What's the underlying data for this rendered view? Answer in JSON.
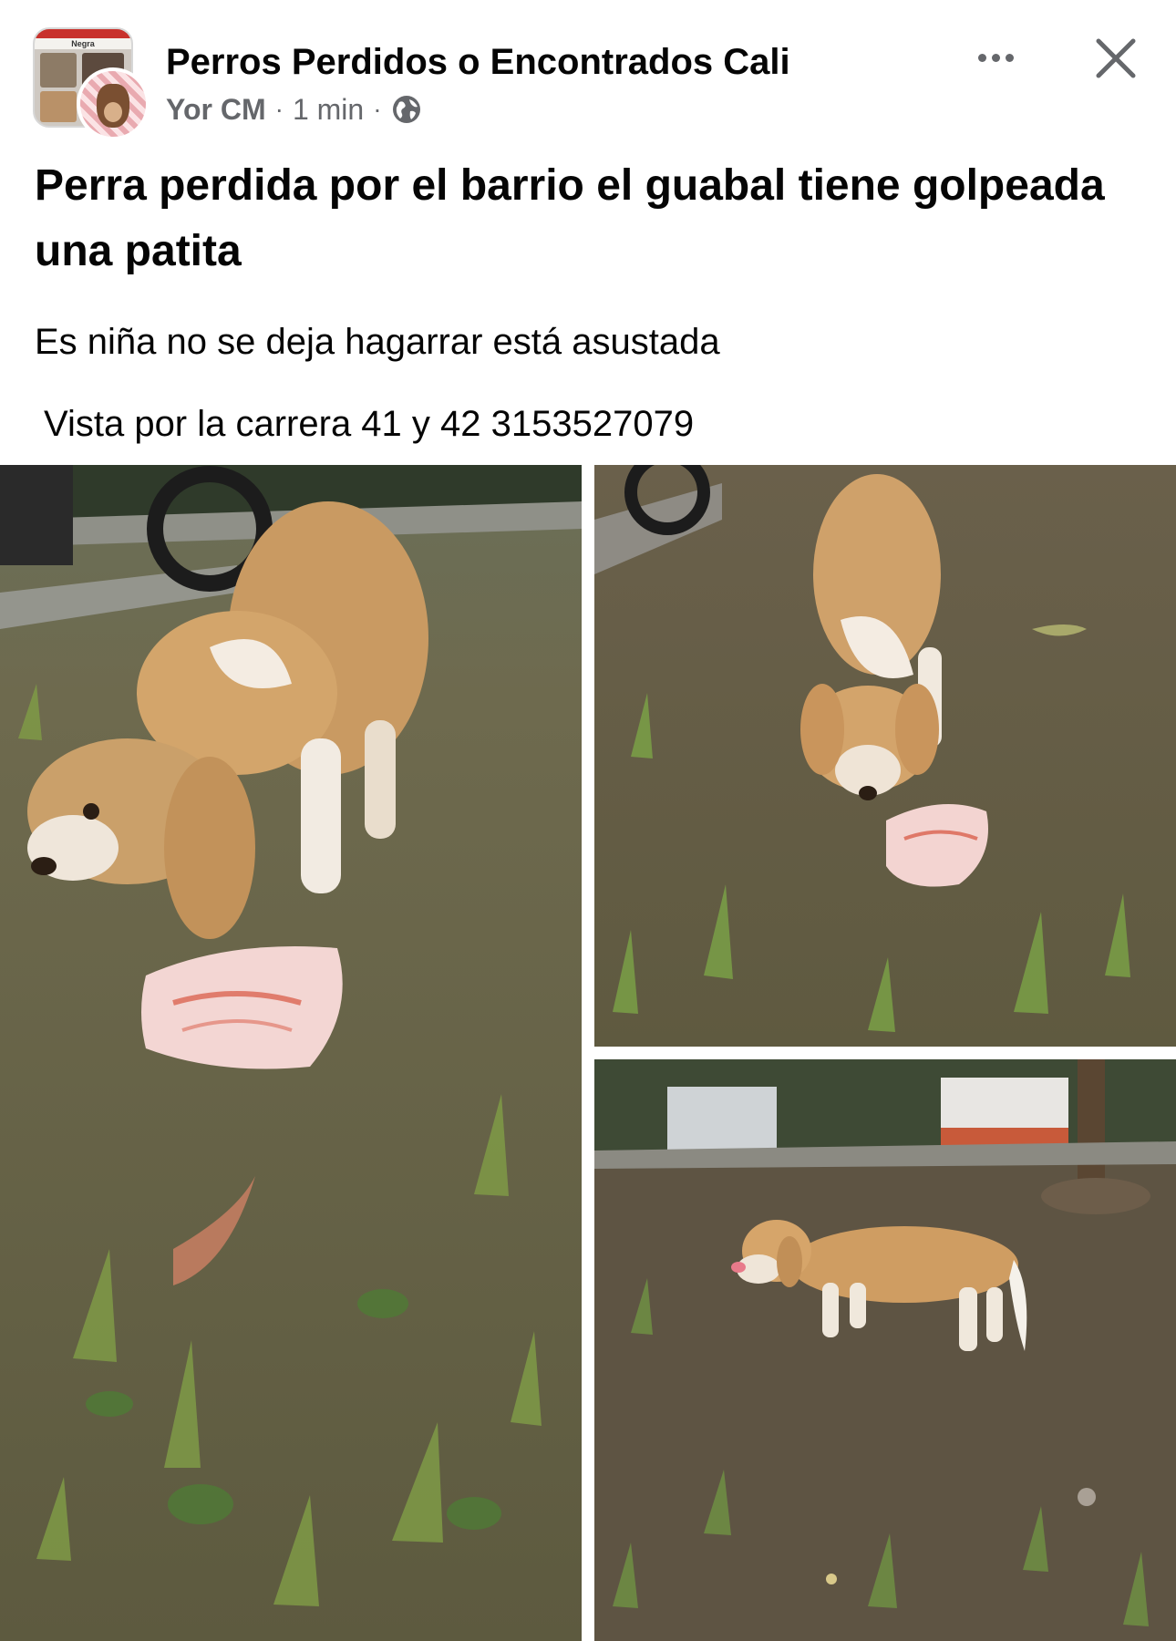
{
  "header": {
    "group_name": "Perros Perdidos o Encontrados Cali",
    "author": "Yor CM",
    "time": "1 min",
    "separator": "·",
    "privacy_icon": "globe-icon",
    "more_icon": "more-dots-icon",
    "close_icon": "close-icon",
    "avatar_badge": "Negra"
  },
  "post": {
    "title": "Perra perdida por el barrio el guabal tiene golpeada una patita",
    "body_line1": "Es niña no se deja hagarrar está asustada",
    "body_line2": "Vista por la carrera 41 y 42 3153527079"
  },
  "photos": [
    {
      "subject": "beagle-sniffing-bag-closeup"
    },
    {
      "subject": "beagle-sniffing-bag-from-above"
    },
    {
      "subject": "beagle-walking-in-yard"
    }
  ],
  "colors": {
    "text_primary": "#050505",
    "text_secondary": "#65676b",
    "background": "#ffffff"
  }
}
